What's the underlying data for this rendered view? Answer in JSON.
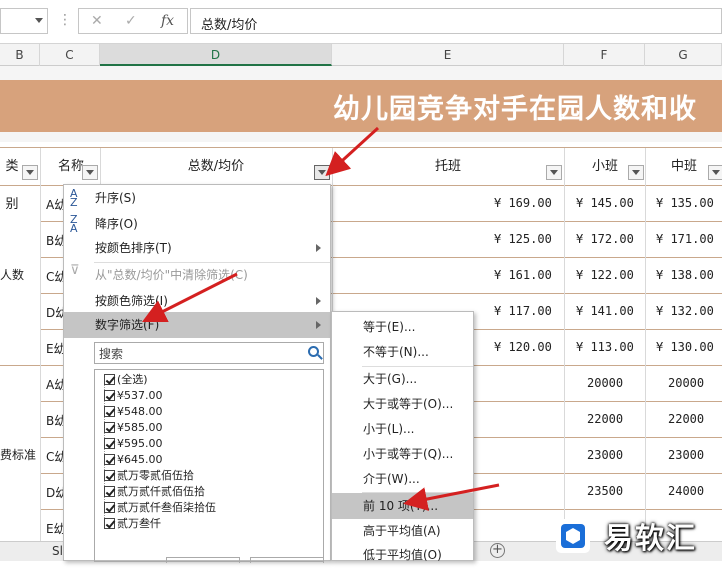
{
  "formula_bar": {
    "fx_label": "fx",
    "cancel_symbol": "✕",
    "confirm_symbol": "✓",
    "dots": "⋮",
    "content": "总数/均价"
  },
  "columns": [
    "B",
    "C",
    "D",
    "E",
    "F",
    "G"
  ],
  "title": "幼儿园竞争对手在园人数和收",
  "headers": {
    "category": "类别",
    "name": "名称",
    "total_avg": "总数/均价",
    "tuoban": "托班",
    "xiaoban": "小班",
    "zhongban": "中班"
  },
  "rows": [
    {
      "name": "A幼",
      "tuoban": "¥ 169.00",
      "xiaoban": "¥ 145.00",
      "zhongban": "¥ 135.00"
    },
    {
      "name": "B幼",
      "tuoban": "¥ 125.00",
      "xiaoban": "¥ 172.00",
      "zhongban": "¥ 171.00"
    },
    {
      "name": "C幼",
      "tuoban": "¥ 161.00",
      "xiaoban": "¥ 122.00",
      "zhongban": "¥ 138.00"
    },
    {
      "name": "D幼",
      "tuoban": "¥ 117.00",
      "xiaoban": "¥ 141.00",
      "zhongban": "¥ 132.00"
    },
    {
      "name": "E幼",
      "tuoban": "¥ 120.00",
      "xiaoban": "¥ 113.00",
      "zhongban": "¥ 130.00"
    },
    {
      "name": "A幼",
      "xiaoban": "20000",
      "zhongban": "20000"
    },
    {
      "name": "B幼",
      "xiaoban": "22000",
      "zhongban": "22000"
    },
    {
      "name": "C幼",
      "xiaoban": "23000",
      "zhongban": "23000"
    },
    {
      "name": "D幼",
      "xiaoban": "23500",
      "zhongban": "24000"
    },
    {
      "name": "E幼",
      "xiaoban": "",
      "zhongban": ""
    }
  ],
  "group_labels": [
    "人数",
    "费标准"
  ],
  "menu": {
    "items": [
      {
        "label": "升序(S)",
        "icon": "sort-ascending-icon",
        "glyph": "A↓Z",
        "disabled": false,
        "submenu": false
      },
      {
        "label": "降序(O)",
        "icon": "sort-descending-icon",
        "glyph": "Z↓A",
        "disabled": false,
        "submenu": false
      },
      {
        "label": "按颜色排序(T)",
        "disabled": false,
        "submenu": true
      },
      {
        "label": "从\"总数/均价\"中清除筛选(C)",
        "icon": "clear-filter-icon",
        "glyph": "▽",
        "disabled": true,
        "submenu": false
      },
      {
        "label": "按颜色筛选(I)",
        "disabled": false,
        "submenu": true
      },
      {
        "label": "数字筛选(F)",
        "disabled": false,
        "submenu": true,
        "selected": true
      }
    ],
    "search_placeholder": "搜索",
    "list": [
      "(全选)",
      "¥537.00",
      "¥548.00",
      "¥585.00",
      "¥595.00",
      "¥645.00",
      "贰万零贰佰伍拾",
      "贰万贰仟贰佰伍拾",
      "贰万贰仟叁佰柒拾伍",
      "贰万叁仟"
    ]
  },
  "submenu": {
    "items": [
      "等于(E)...",
      "不等于(N)...",
      "大于(G)...",
      "大于或等于(O)...",
      "小于(L)...",
      "小于或等于(Q)...",
      "介于(W)...",
      "前 10 项(T)...",
      "高于平均值(A)",
      "低于平均值(O)"
    ],
    "selected_index": 7
  },
  "sheet_tabs": {
    "first": "Sl"
  },
  "watermark": {
    "text": "易软汇"
  },
  "colors": {
    "title_band": "#d7a27c",
    "selected_menu": "#c5c5c5",
    "arrow_red": "#d42020"
  }
}
